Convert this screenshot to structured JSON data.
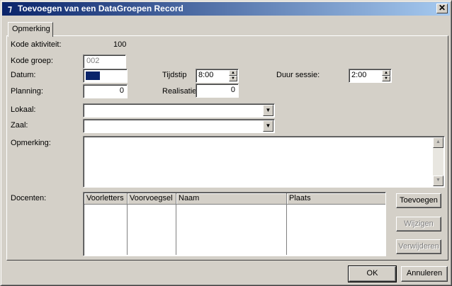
{
  "window": {
    "title": "Toevoegen van een DataGroepen Record",
    "close_glyph": "✕",
    "icon_glyph": "⁊"
  },
  "tabs": [
    {
      "label": "Opmerking"
    }
  ],
  "form": {
    "kode_aktiviteit_label": "Kode aktiviteit:",
    "kode_aktiviteit_value": "100",
    "kode_groep_label": "Kode groep:",
    "kode_groep_value": "002",
    "datum_label": "Datum:",
    "datum_value": "",
    "tijdstip_label": "Tijdstip",
    "tijdstip_value": "8:00",
    "duur_sessie_label": "Duur sessie:",
    "duur_sessie_value": "2:00",
    "planning_label": "Planning:",
    "planning_value": "0",
    "realisatie_label": "Realisatie:",
    "realisatie_value": "0",
    "lokaal_label": "Lokaal:",
    "lokaal_value": "",
    "zaal_label": "Zaal:",
    "zaal_value": "",
    "opmerking_label": "Opmerking:",
    "opmerking_value": "",
    "docenten_label": "Docenten:"
  },
  "docenten_table": {
    "columns": [
      "Voorletters",
      "Voorvoegsel",
      "Naam",
      "Plaats"
    ],
    "rows": []
  },
  "side_buttons": {
    "toevoegen": "Toevoegen",
    "wijzigen": "Wijzigen",
    "verwijderen": "Verwijderen"
  },
  "footer": {
    "ok": "OK",
    "annuleren": "Annuleren"
  },
  "icons": {
    "spin_up": "▲",
    "spin_down": "▼",
    "dropdown": "▼"
  },
  "colors": {
    "titlebar_start": "#0a246a",
    "titlebar_end": "#a6caf0",
    "face": "#d4d0c8"
  }
}
